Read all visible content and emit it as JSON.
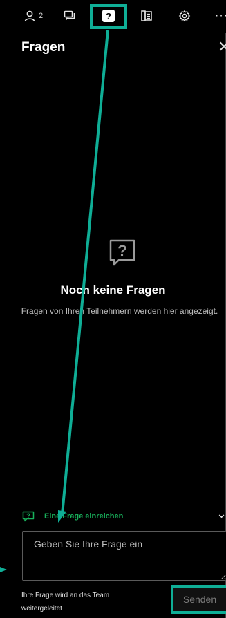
{
  "topbar": {
    "participants_count": "2",
    "icons": [
      "person-icon",
      "chat-icon",
      "question-icon",
      "notes-icon",
      "settings-icon",
      "more-icon"
    ],
    "active_tab": "question-icon",
    "highlight_color": "#0fae96"
  },
  "panel": {
    "title": "Fragen",
    "close_icon": "close-icon"
  },
  "empty_state": {
    "icon": "question-bubble-icon",
    "title": "Noch keine Fragen",
    "description": "Fragen von Ihren Teilnehmern werden hier angezeigt."
  },
  "submit": {
    "label": "Eine Frage einreichen",
    "label_color": "#18b05b",
    "placeholder": "Geben Sie Ihre Frage ein",
    "value": "",
    "note": "Ihre Frage wird an das Team weitergeleitet",
    "send_label": "Senden"
  }
}
